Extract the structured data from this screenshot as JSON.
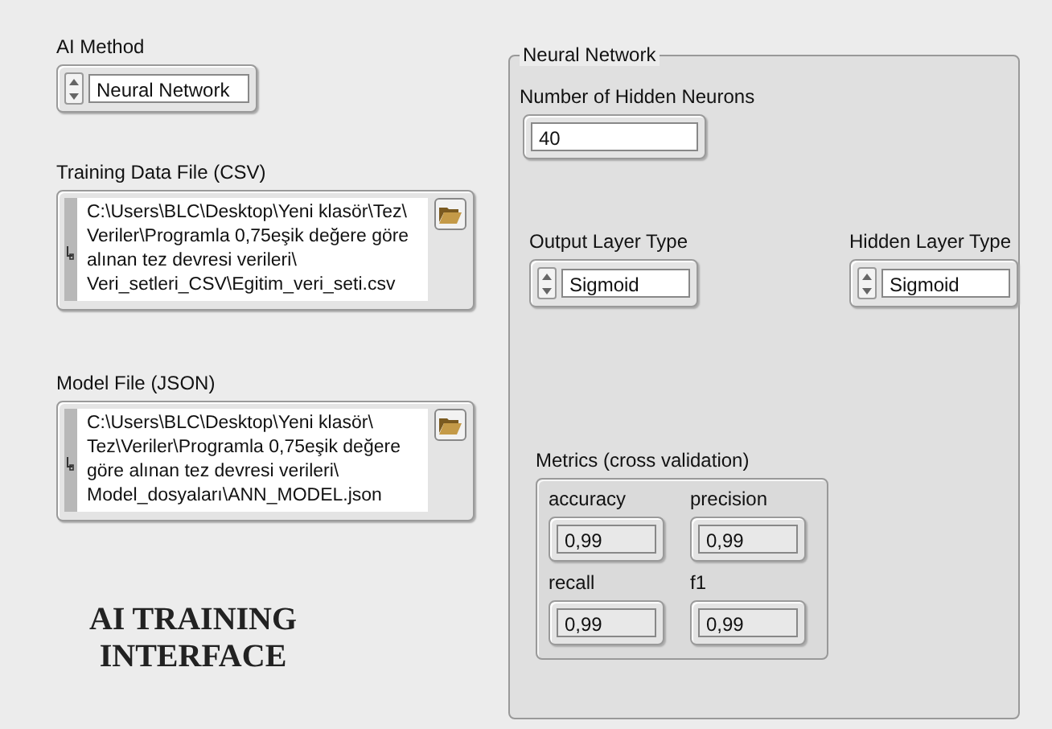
{
  "ai_method": {
    "label": "AI Method",
    "value": "Neural Network"
  },
  "training_file": {
    "label": "Training Data File (CSV)",
    "lines": [
      "C:\\Users\\BLC\\Desktop\\Yeni klasör\\Tez\\",
      "Veriler\\Programla 0,75eşik değere göre",
      "alınan tez devresi verileri\\",
      "Veri_setleri_CSV\\Egitim_veri_seti.csv"
    ]
  },
  "model_file": {
    "label": "Model File (JSON)",
    "lines": [
      "C:\\Users\\BLC\\Desktop\\Yeni klasör\\",
      "Tez\\Veriler\\Programla 0,75eşik değere",
      "göre alınan tez devresi verileri\\",
      "Model_dosyaları\\ANN_MODEL.json"
    ]
  },
  "title": "AI TRAINING INTERFACE",
  "neural_network": {
    "title": "Neural Network",
    "hidden_neurons": {
      "label": "Number of Hidden Neurons",
      "value": "40"
    },
    "output_layer": {
      "label": "Output Layer Type",
      "value": "Sigmoid"
    },
    "hidden_layer": {
      "label": "Hidden Layer Type",
      "value": "Sigmoid"
    },
    "metrics": {
      "label": "Metrics (cross validation)",
      "items": [
        {
          "label": "accuracy",
          "value": "0,99"
        },
        {
          "label": "precision",
          "value": "0,99"
        },
        {
          "label": "recall",
          "value": "0,99"
        },
        {
          "label": "f1",
          "value": "0,99"
        }
      ]
    }
  }
}
